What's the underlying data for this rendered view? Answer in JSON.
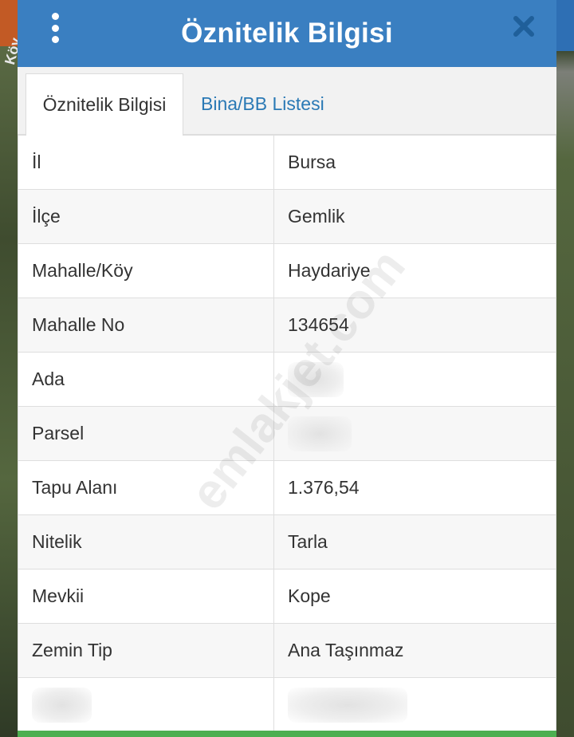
{
  "map": {
    "label": "Köy"
  },
  "header": {
    "title": "Öznitelik Bilgisi",
    "menu_icon": "kebab-menu-icon",
    "close_icon": "close-icon"
  },
  "tabs": [
    {
      "label": "Öznitelik Bilgisi",
      "active": true
    },
    {
      "label": "Bina/BB Listesi",
      "active": false
    }
  ],
  "rows": [
    {
      "key": "İl",
      "value": "Bursa"
    },
    {
      "key": "İlçe",
      "value": "Gemlik"
    },
    {
      "key": "Mahalle/Köy",
      "value": "Haydariye"
    },
    {
      "key": "Mahalle No",
      "value": "134654"
    },
    {
      "key": "Ada",
      "value": ""
    },
    {
      "key": "Parsel",
      "value": ""
    },
    {
      "key": "Tapu Alanı",
      "value": "1.376,54"
    },
    {
      "key": "Nitelik",
      "value": "Tarla"
    },
    {
      "key": "Mevkii",
      "value": "Kope"
    },
    {
      "key": "Zemin Tip",
      "value": "Ana Taşınmaz"
    },
    {
      "key": "",
      "value": ""
    }
  ],
  "watermark": "emlakjet.com",
  "colors": {
    "header": "#3a7fc1",
    "tab_link": "#2a79b5",
    "bottom_bar": "#4caf50"
  }
}
